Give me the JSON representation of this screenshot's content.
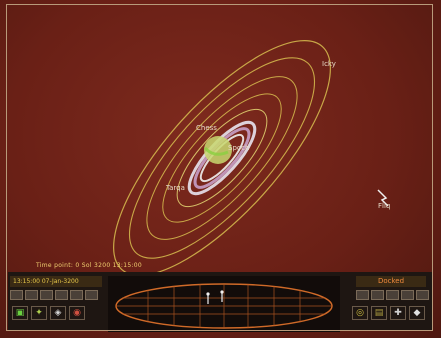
{
  "hud": {
    "time_readout": "Time point: 0 Sol 3200 13:15:00",
    "stardate": "13:15:00 07-Jan-3200",
    "status": "Docked"
  },
  "planet_labels": {
    "outer": "Icky",
    "inner_1": "Chess",
    "inner_2": "Spoch",
    "inner_3": "Tarqa",
    "ship": "Fliq"
  },
  "colors": {
    "space_background": "#6a2016",
    "orbit_lines": "#d8c050",
    "panel_background": "#1e1612",
    "readout_text": "#f0d070",
    "status_text": "#f08a3c",
    "scanner_lines": "#d06a28"
  },
  "icons": {
    "left_panel": [
      {
        "name": "view-icon",
        "glyph": "▣",
        "color": "#6ad040"
      },
      {
        "name": "star-map-icon",
        "glyph": "✦",
        "color": "#b0d050"
      },
      {
        "name": "comms-icon",
        "glyph": "◈",
        "color": "#d8d8d8"
      },
      {
        "name": "info-icon",
        "glyph": "◉",
        "color": "#d05040"
      }
    ],
    "right_panel": [
      {
        "name": "target-icon",
        "glyph": "◎",
        "color": "#d0c040"
      },
      {
        "name": "cargo-icon",
        "glyph": "▤",
        "color": "#b0a040"
      },
      {
        "name": "equipment-icon",
        "glyph": "✚",
        "color": "#d0d0d0"
      },
      {
        "name": "status-icon",
        "glyph": "◆",
        "color": "#e0e0e0"
      }
    ]
  }
}
